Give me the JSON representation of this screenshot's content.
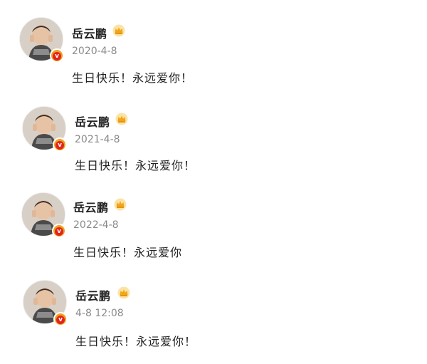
{
  "posts": [
    {
      "username": "岳云鹏",
      "timestamp": "2020-4-8",
      "content": "生日快乐！永远爱你！"
    },
    {
      "username": "岳云鹏",
      "timestamp": "2021-4-8",
      "content": "生日快乐！永远爱你！"
    },
    {
      "username": "岳云鹏",
      "timestamp": "2022-4-8",
      "content": "生日快乐！永远爱你"
    },
    {
      "username": "岳云鹏",
      "timestamp": "4-8 12:08",
      "content": "生日快乐！永远爱你！"
    }
  ],
  "badge": {
    "verified_mark": "v"
  },
  "icons": {
    "crown": "crown-icon",
    "verified": "verified-badge-icon",
    "avatar": "avatar-photo"
  },
  "colors": {
    "crown": "#f2a51a",
    "verified_outer": "#f0a020",
    "verified_inner": "#e2241a",
    "timestamp": "#8a8a8a"
  }
}
